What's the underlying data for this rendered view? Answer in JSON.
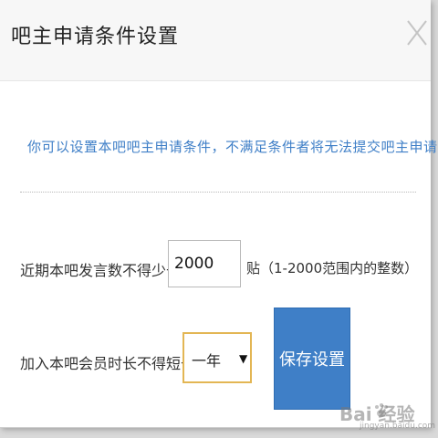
{
  "dialog": {
    "title": "吧主申请条件设置",
    "notice": "你可以设置本吧吧主申请条件，不满足条件者将无法提交吧主申请"
  },
  "posts": {
    "label": "近期本吧发言数不得少于",
    "value": "2000",
    "suffix": "贴（1-2000范围内的整数）"
  },
  "membership": {
    "label": "加入本吧会员时长不得短于",
    "selected": "一年"
  },
  "actions": {
    "save_label": "保存设置"
  },
  "watermark": {
    "brand": "Bai 经验",
    "url": "jingyan.baidu.com"
  },
  "icons": {
    "close": "close-icon",
    "dropdown": "dropdown-arrow-icon",
    "logo": "baidu-paw-icon"
  },
  "colors": {
    "accent": "#3f7fc7",
    "select_border": "#e3b654"
  }
}
